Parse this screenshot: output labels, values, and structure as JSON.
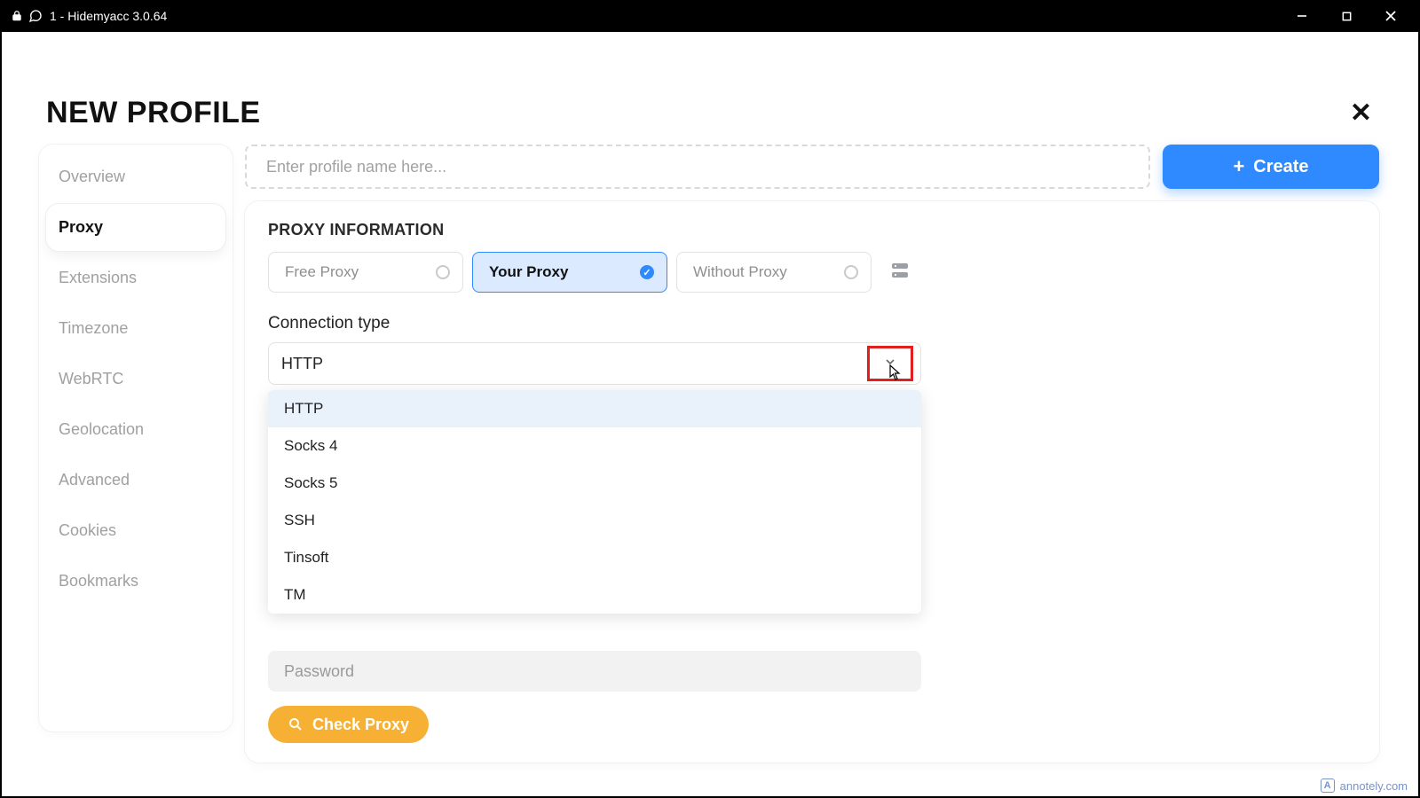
{
  "titlebar": {
    "app_title": "1 - Hidemyacc 3.0.64"
  },
  "header": {
    "title": "NEW PROFILE"
  },
  "sidebar": {
    "items": [
      {
        "label": "Overview"
      },
      {
        "label": "Proxy"
      },
      {
        "label": "Extensions"
      },
      {
        "label": "Timezone"
      },
      {
        "label": "WebRTC"
      },
      {
        "label": "Geolocation"
      },
      {
        "label": "Advanced"
      },
      {
        "label": "Cookies"
      },
      {
        "label": "Bookmarks"
      }
    ]
  },
  "top": {
    "name_placeholder": "Enter profile name here...",
    "create_label": "Create"
  },
  "proxy": {
    "section_title": "PROXY INFORMATION",
    "options": {
      "free": "Free Proxy",
      "your": "Your Proxy",
      "without": "Without Proxy"
    },
    "connection_label": "Connection type",
    "connection_value": "HTTP",
    "connection_options": [
      "HTTP",
      "Socks 4",
      "Socks 5",
      "SSH",
      "Tinsoft",
      "TM"
    ],
    "password_placeholder": "Password",
    "check_label": "Check Proxy"
  },
  "watermark": {
    "text": "annotely.com"
  }
}
